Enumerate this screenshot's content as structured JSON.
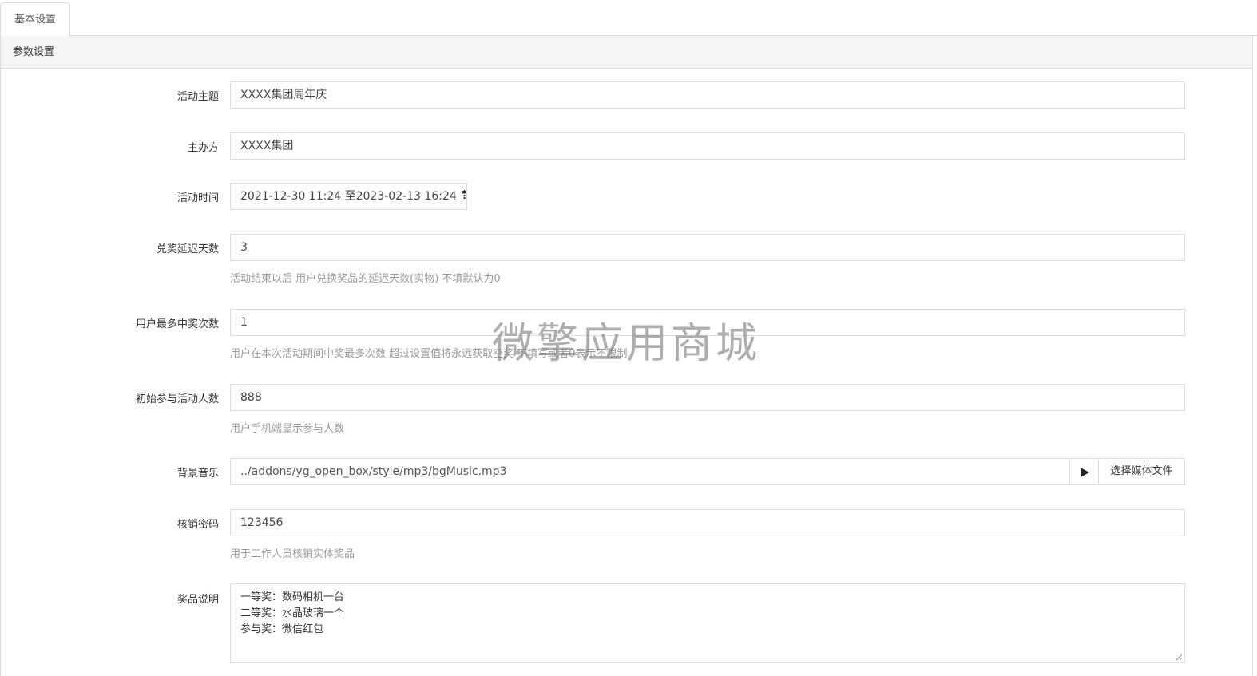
{
  "tabs": [
    {
      "label": "基本设置"
    }
  ],
  "panel": {
    "heading": "参数设置"
  },
  "form": {
    "theme": {
      "label": "活动主题",
      "value": "XXXX集团周年庆"
    },
    "organizer": {
      "label": "主办方",
      "value": "XXXX集团"
    },
    "time": {
      "label": "活动时间",
      "value": "2021-12-30 11:24 至2023-02-13 16:24"
    },
    "delay_days": {
      "label": "兑奖延迟天数",
      "value": "3",
      "help": "活动结束以后 用户兑换奖品的延迟天数(实物) 不填默认为0"
    },
    "max_wins": {
      "label": "用户最多中奖次数",
      "value": "1",
      "help": "用户在本次活动期间中奖最多次数 超过设置值将永远获取空奖 不填写或者0表示不限制"
    },
    "initial_participants": {
      "label": "初始参与活动人数",
      "value": "888",
      "help": "用户手机端显示参与人数"
    },
    "bg_music": {
      "label": "背景音乐",
      "value": "../addons/yg_open_box/style/mp3/bgMusic.mp3",
      "button_label": "选择媒体文件"
    },
    "verify_password": {
      "label": "核销密码",
      "value": "123456",
      "help": "用于工作人员核销实体奖品"
    },
    "prize_desc": {
      "label": "奖品说明",
      "lines": [
        "一等奖：数码相机一台",
        "二等奖：水晶玻璃一个",
        "参与奖：微信红包"
      ]
    }
  },
  "watermark": "微擎应用商城",
  "icons": {
    "calendar": "calendar-icon",
    "play": "play-icon"
  }
}
